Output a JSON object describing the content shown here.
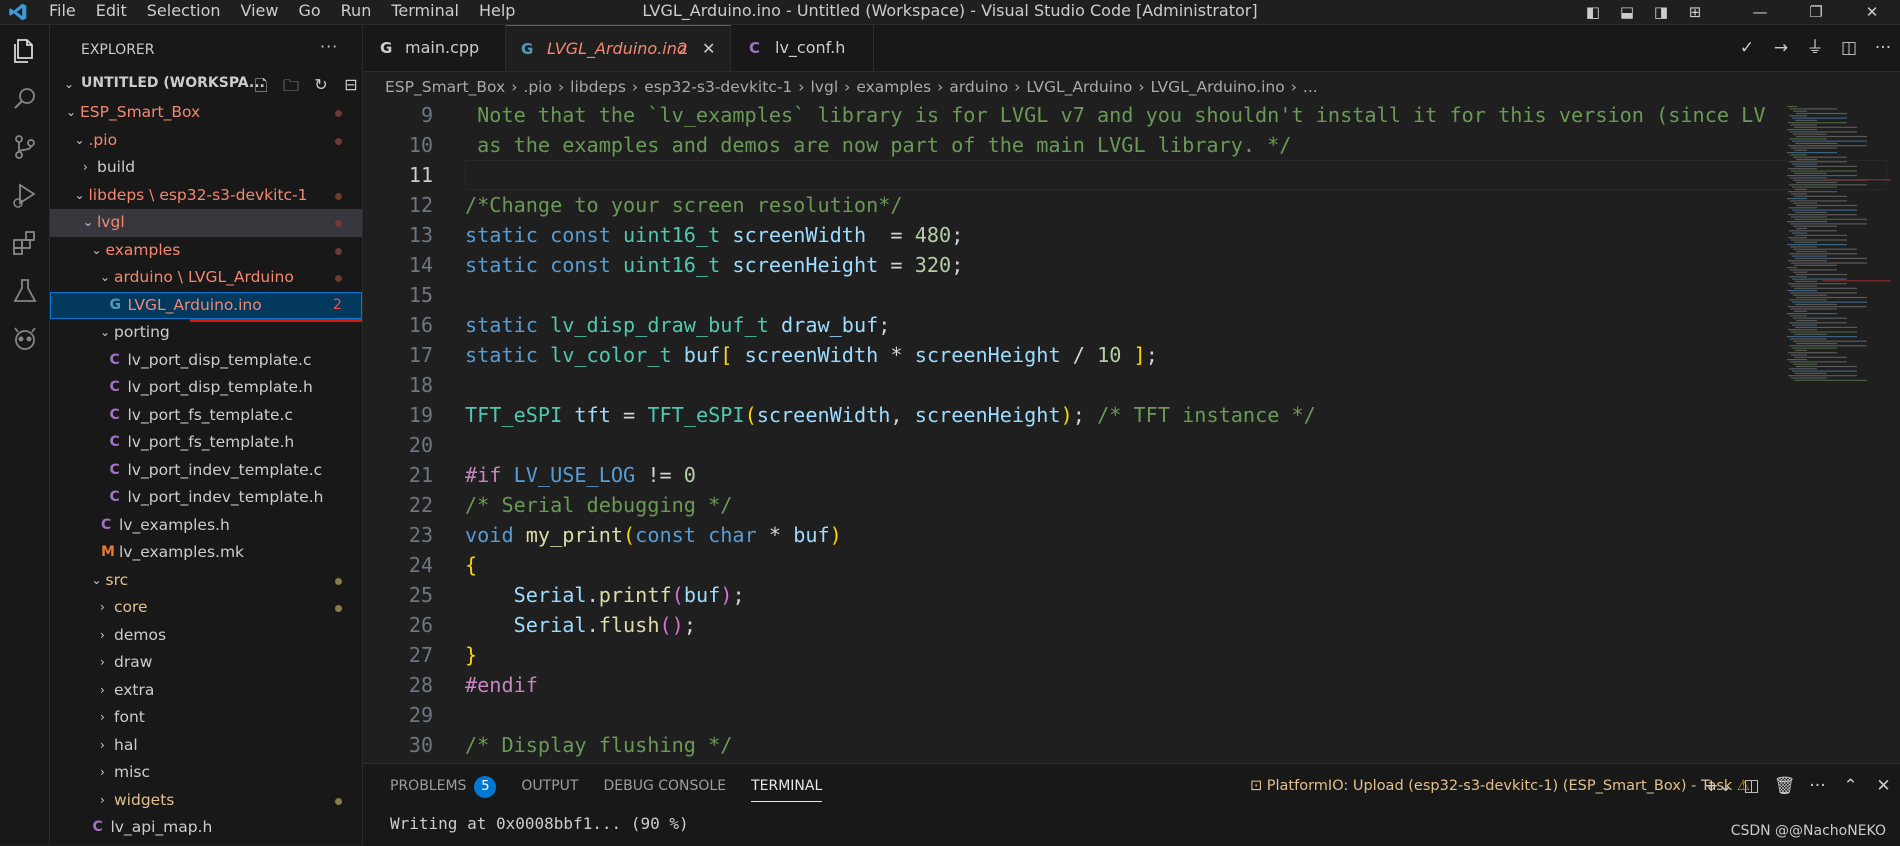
{
  "menu": [
    "File",
    "Edit",
    "Selection",
    "View",
    "Go",
    "Run",
    "Terminal",
    "Help"
  ],
  "window_title": "LVGL_Arduino.ino - Untitled (Workspace) - Visual Studio Code [Administrator]",
  "sidebar": {
    "title": "EXPLORER",
    "more": "···",
    "workspace": "UNTITLED (WORKSPA...",
    "tree": [
      {
        "label": "ESP_Smart_Box",
        "indent": 0,
        "chev": "down",
        "color": "red",
        "dot": "red"
      },
      {
        "label": ".pio",
        "indent": 1,
        "chev": "down",
        "color": "red",
        "dot": "red"
      },
      {
        "label": "build",
        "indent": 2,
        "chev": "right",
        "color": "def"
      },
      {
        "label": "libdeps \\ esp32-s3-devkitc-1",
        "indent": 1,
        "chev": "down",
        "color": "red",
        "dot": "red"
      },
      {
        "label": "lvgl",
        "indent": 2,
        "chev": "down",
        "color": "red",
        "dot": "red",
        "sel": true
      },
      {
        "label": "examples",
        "indent": 3,
        "chev": "down",
        "color": "red",
        "dot": "red"
      },
      {
        "label": "arduino \\ LVGL_Arduino",
        "indent": 4,
        "chev": "down",
        "color": "red",
        "dot": "red"
      },
      {
        "label": "LVGL_Arduino.ino",
        "indent": 5,
        "icon": "G",
        "iconcolor": "#519aba",
        "color": "red",
        "count": "2",
        "active": true
      },
      {
        "label": "porting",
        "indent": 4,
        "chev": "down",
        "color": "def"
      },
      {
        "label": "lv_port_disp_template.c",
        "indent": 5,
        "icon": "C",
        "iconcolor": "#a074c4",
        "color": "def"
      },
      {
        "label": "lv_port_disp_template.h",
        "indent": 5,
        "icon": "C",
        "iconcolor": "#a074c4",
        "color": "def"
      },
      {
        "label": "lv_port_fs_template.c",
        "indent": 5,
        "icon": "C",
        "iconcolor": "#a074c4",
        "color": "def"
      },
      {
        "label": "lv_port_fs_template.h",
        "indent": 5,
        "icon": "C",
        "iconcolor": "#a074c4",
        "color": "def"
      },
      {
        "label": "lv_port_indev_template.c",
        "indent": 5,
        "icon": "C",
        "iconcolor": "#a074c4",
        "color": "def"
      },
      {
        "label": "lv_port_indev_template.h",
        "indent": 5,
        "icon": "C",
        "iconcolor": "#a074c4",
        "color": "def"
      },
      {
        "label": "lv_examples.h",
        "indent": 4,
        "icon": "C",
        "iconcolor": "#a074c4",
        "color": "def"
      },
      {
        "label": "lv_examples.mk",
        "indent": 4,
        "icon": "M",
        "iconcolor": "#e37933",
        "color": "def"
      },
      {
        "label": "src",
        "indent": 3,
        "chev": "down",
        "color": "mod",
        "dot": "yel"
      },
      {
        "label": "core",
        "indent": 4,
        "chev": "right",
        "color": "mod",
        "dot": "yel"
      },
      {
        "label": "demos",
        "indent": 4,
        "chev": "right",
        "color": "def"
      },
      {
        "label": "draw",
        "indent": 4,
        "chev": "right",
        "color": "def"
      },
      {
        "label": "extra",
        "indent": 4,
        "chev": "right",
        "color": "def"
      },
      {
        "label": "font",
        "indent": 4,
        "chev": "right",
        "color": "def"
      },
      {
        "label": "hal",
        "indent": 4,
        "chev": "right",
        "color": "def"
      },
      {
        "label": "misc",
        "indent": 4,
        "chev": "right",
        "color": "def"
      },
      {
        "label": "widgets",
        "indent": 4,
        "chev": "right",
        "color": "mod",
        "dot": "yel"
      },
      {
        "label": "lv_api_map.h",
        "indent": 3,
        "icon": "C",
        "iconcolor": "#a074c4",
        "color": "def"
      }
    ]
  },
  "tabs": [
    {
      "label": "main.cpp",
      "icon": "G",
      "iconcolor": "#519aba"
    },
    {
      "label": "LVGL_Arduino.ino",
      "icon": "G",
      "iconcolor": "#519aba",
      "badge": "2",
      "close": "✕",
      "active": true
    },
    {
      "label": "lv_conf.h",
      "icon": "C",
      "iconcolor": "#a074c4"
    }
  ],
  "breadcrumb": [
    "ESP_Smart_Box",
    "›",
    ".pio",
    "›",
    "libdeps",
    "›",
    "esp32-s3-devkitc-1",
    "›",
    "lvgl",
    "›",
    "examples",
    "›",
    "arduino",
    "›",
    "LVGL_Arduino",
    "›",
    "LVGL_Arduino.ino",
    "›",
    "..."
  ],
  "editor": {
    "current_line": 11,
    "lines": [
      {
        "n": "9",
        "tokens": [
          [
            "c",
            " Note that the `lv_examples` library is for LVGL v7 and you shouldn't install it for this version (since LV"
          ]
        ]
      },
      {
        "n": "10",
        "tokens": [
          [
            "c",
            " as the examples and demos are now part of the main LVGL library. */"
          ]
        ]
      },
      {
        "n": "11",
        "tokens": []
      },
      {
        "n": "12",
        "tokens": [
          [
            "c",
            "/*Change to your screen resolution*/"
          ]
        ]
      },
      {
        "n": "13",
        "tokens": [
          [
            "k",
            "static"
          ],
          [
            "d",
            " "
          ],
          [
            "k",
            "const"
          ],
          [
            "d",
            " "
          ],
          [
            "t",
            "uint16_t"
          ],
          [
            "d",
            " "
          ],
          [
            "v",
            "screenWidth"
          ],
          [
            "d",
            "  = "
          ],
          [
            "n",
            "480"
          ],
          [
            "d",
            ";"
          ]
        ]
      },
      {
        "n": "14",
        "tokens": [
          [
            "k",
            "static"
          ],
          [
            "d",
            " "
          ],
          [
            "k",
            "const"
          ],
          [
            "d",
            " "
          ],
          [
            "t",
            "uint16_t"
          ],
          [
            "d",
            " "
          ],
          [
            "v",
            "screenHeight"
          ],
          [
            "d",
            " = "
          ],
          [
            "n",
            "320"
          ],
          [
            "d",
            ";"
          ]
        ]
      },
      {
        "n": "15",
        "tokens": []
      },
      {
        "n": "16",
        "tokens": [
          [
            "k",
            "static"
          ],
          [
            "d",
            " "
          ],
          [
            "t",
            "lv_disp_draw_buf_t"
          ],
          [
            "d",
            " "
          ],
          [
            "v",
            "draw_buf"
          ],
          [
            "d",
            ";"
          ]
        ]
      },
      {
        "n": "17",
        "tokens": [
          [
            "k",
            "static"
          ],
          [
            "d",
            " "
          ],
          [
            "t",
            "lv_color_t"
          ],
          [
            "d",
            " "
          ],
          [
            "v",
            "buf"
          ],
          [
            "b",
            "["
          ],
          [
            "d",
            " "
          ],
          [
            "v",
            "screenWidth"
          ],
          [
            "d",
            " * "
          ],
          [
            "v",
            "screenHeight"
          ],
          [
            "d",
            " / "
          ],
          [
            "n",
            "10"
          ],
          [
            "d",
            " "
          ],
          [
            "b",
            "]"
          ],
          [
            "d",
            ";"
          ]
        ]
      },
      {
        "n": "18",
        "tokens": []
      },
      {
        "n": "19",
        "tokens": [
          [
            "t",
            "TFT_eSPI"
          ],
          [
            "d",
            " "
          ],
          [
            "v",
            "tft"
          ],
          [
            "d",
            " = "
          ],
          [
            "t",
            "TFT_eSPI"
          ],
          [
            "b",
            "("
          ],
          [
            "v",
            "screenWidth"
          ],
          [
            "d",
            ", "
          ],
          [
            "v",
            "screenHeight"
          ],
          [
            "b",
            ")"
          ],
          [
            "d",
            "; "
          ],
          [
            "c",
            "/* TFT instance */"
          ]
        ]
      },
      {
        "n": "20",
        "tokens": []
      },
      {
        "n": "21",
        "tokens": [
          [
            "p",
            "#if"
          ],
          [
            "d",
            " "
          ],
          [
            "k",
            "LV_USE_LOG"
          ],
          [
            "d",
            " != "
          ],
          [
            "n",
            "0"
          ]
        ]
      },
      {
        "n": "22",
        "tokens": [
          [
            "c",
            "/* Serial debugging */"
          ]
        ]
      },
      {
        "n": "23",
        "tokens": [
          [
            "k",
            "void"
          ],
          [
            "d",
            " "
          ],
          [
            "f",
            "my_print"
          ],
          [
            "b",
            "("
          ],
          [
            "k",
            "const"
          ],
          [
            "d",
            " "
          ],
          [
            "k",
            "char"
          ],
          [
            "d",
            " * "
          ],
          [
            "v",
            "buf"
          ],
          [
            "b",
            ")"
          ]
        ]
      },
      {
        "n": "24",
        "tokens": [
          [
            "b",
            "{"
          ]
        ]
      },
      {
        "n": "25",
        "tokens": [
          [
            "d",
            "    "
          ],
          [
            "v",
            "Serial"
          ],
          [
            "d",
            "."
          ],
          [
            "f",
            "printf"
          ],
          [
            "b2",
            "("
          ],
          [
            "v",
            "buf"
          ],
          [
            "b2",
            ")"
          ],
          [
            "d",
            ";"
          ]
        ]
      },
      {
        "n": "26",
        "tokens": [
          [
            "d",
            "    "
          ],
          [
            "v",
            "Serial"
          ],
          [
            "d",
            "."
          ],
          [
            "f",
            "flush"
          ],
          [
            "b2",
            "()"
          ],
          [
            "d",
            ";"
          ]
        ]
      },
      {
        "n": "27",
        "tokens": [
          [
            "b",
            "}"
          ]
        ]
      },
      {
        "n": "28",
        "tokens": [
          [
            "p",
            "#endif"
          ]
        ]
      },
      {
        "n": "29",
        "tokens": []
      },
      {
        "n": "30",
        "tokens": [
          [
            "c",
            "/* Display flushing */"
          ]
        ]
      }
    ]
  },
  "panel": {
    "tabs": [
      "PROBLEMS",
      "OUTPUT",
      "DEBUG CONSOLE",
      "TERMINAL"
    ],
    "active_tab": "TERMINAL",
    "problems_count": "5",
    "task": "PlatformIO: Upload (esp32-s3-devkitc-1) (ESP_Smart_Box) - Task",
    "terminal_text": "Writing at 0x0008bbf1... (90 %)"
  },
  "watermark": "CSDN @@NachoNEKO",
  "colors": {
    "accent": "#0078d4",
    "error": "#f48771",
    "modified": "#e2c08d",
    "highlight": "#e51400"
  }
}
